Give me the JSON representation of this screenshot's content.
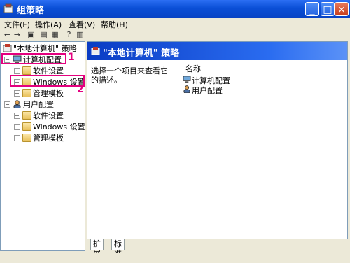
{
  "window": {
    "title": "组策略"
  },
  "menu": [
    "文件(F)",
    "操作(A)",
    "查看(V)",
    "帮助(H)"
  ],
  "toolbar_icons": [
    "back-icon",
    "forward-icon",
    "up-icon",
    "properties-icon",
    "export-icon",
    "help-icon",
    "console-icon"
  ],
  "tree": {
    "root": "\"本地计算机\" 策略",
    "computer": "计算机配置",
    "computer_children": [
      "软件设置",
      "Windows 设置",
      "管理模板"
    ],
    "user": "用户配置",
    "user_children": [
      "软件设置",
      "Windows 设置",
      "管理模板"
    ]
  },
  "detail": {
    "banner": "\"本地计算机\" 策略",
    "description": "选择一个项目来查看它的描述。",
    "column": "名称",
    "items": [
      "计算机配置",
      "用户配置"
    ]
  },
  "tabs": [
    "扩展",
    "标准"
  ],
  "annotations": {
    "one": "1",
    "two": "2"
  },
  "colors": {
    "highlight": "#e4007f",
    "title_blue": "#0a4fd6"
  }
}
